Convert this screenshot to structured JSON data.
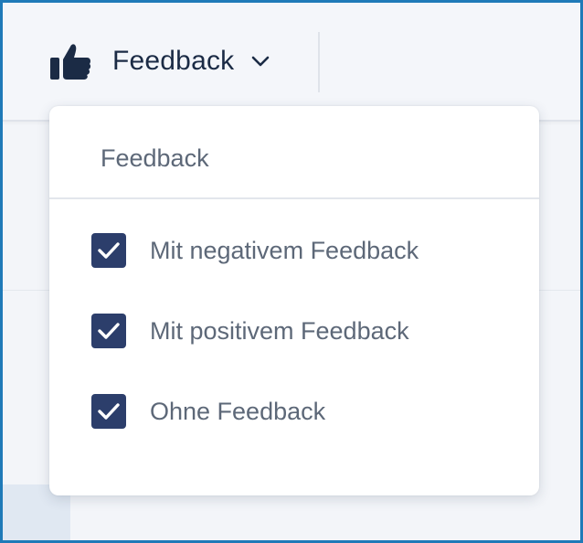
{
  "toolbar": {
    "filter_label": "Feedback",
    "filter_icon": "thumbs-up-icon",
    "expand_icon": "chevron-down-icon"
  },
  "dropdown": {
    "title": "Feedback",
    "options": [
      {
        "label": "Mit negativem Feedback",
        "checked": true
      },
      {
        "label": "Mit positivem Feedback",
        "checked": true
      },
      {
        "label": "Ohne Feedback",
        "checked": true
      }
    ]
  },
  "colors": {
    "brand_dark": "#1b2b45",
    "checkbox_fill": "#2c3e6b",
    "muted_text": "#5d6878",
    "frame_border": "#1f7ab8"
  }
}
